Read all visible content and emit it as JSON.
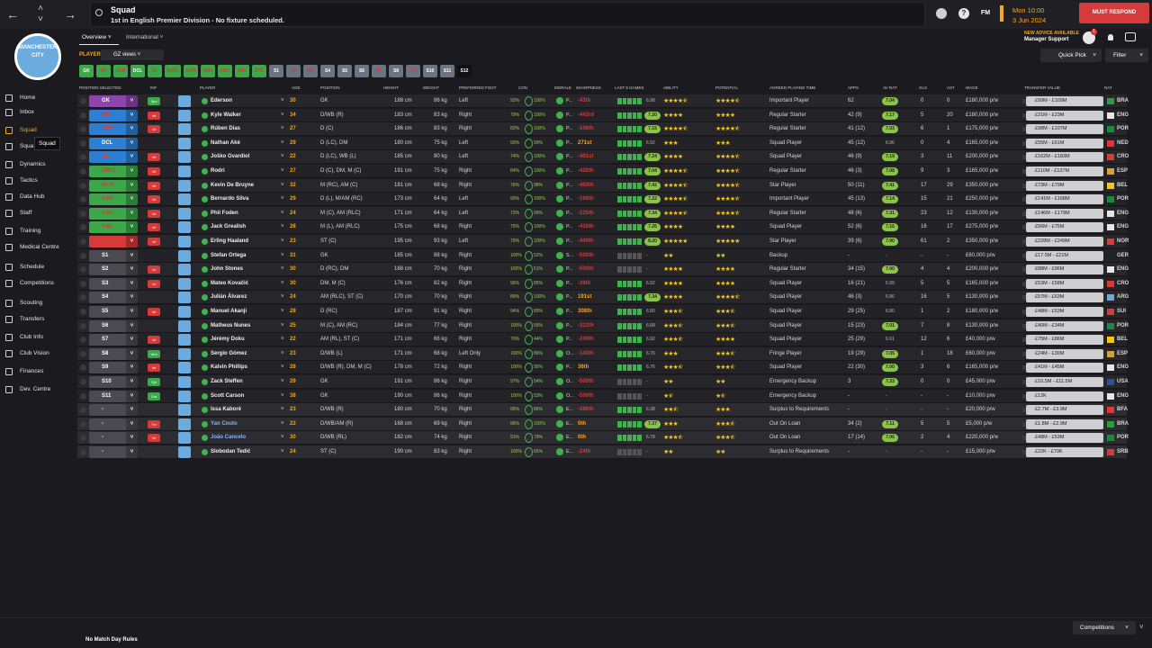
{
  "topbar": {
    "back": "←",
    "up": "˄",
    "down": "˅",
    "forward": "→",
    "title": "Squad",
    "subtitle": "1st in English Premier Division - No fixture scheduled.",
    "help": "?",
    "fm": "FM",
    "date_time": "Mon 10:00",
    "date": "3 Jun 2024",
    "must_respond": "MUST RESPOND"
  },
  "club": {
    "crest_text": "MANCHESTER CITY"
  },
  "sidebar": {
    "items": [
      {
        "label": "Home"
      },
      {
        "label": "Inbox"
      },
      {
        "label": "Squad"
      },
      {
        "label": "Squa"
      },
      {
        "label": "Dynamics"
      },
      {
        "label": "Tactics"
      },
      {
        "label": "Data Hub"
      },
      {
        "label": "Staff"
      },
      {
        "label": "Training"
      },
      {
        "label": "Medical Centre"
      },
      {
        "label": "Schedule"
      },
      {
        "label": "Competitions"
      },
      {
        "label": "Scouting"
      },
      {
        "label": "Transfers"
      },
      {
        "label": "Club Info"
      },
      {
        "label": "Club Vision"
      },
      {
        "label": "Finances"
      },
      {
        "label": "Dev. Centre"
      }
    ],
    "tooltip": "Squad"
  },
  "tabs": {
    "overview": "Overview",
    "international": "International"
  },
  "advice": {
    "new": "NEW ADVICE AVAILABLE",
    "label": "Manager Support",
    "count": "1"
  },
  "players_label": "PLAYERS",
  "view_select": "GZ views",
  "quick_pick": "Quick Pick",
  "filter": "Filter",
  "position_filters": [
    "GK",
    "DR",
    "DCR",
    "DCL",
    "DL",
    "DMCL",
    "MCR",
    "AMR",
    "AMC",
    "AML",
    "STC",
    "S1",
    "S2",
    "S3",
    "S4",
    "S5",
    "S6",
    "S7",
    "S8",
    "S9",
    "S10",
    "S11",
    "S12"
  ],
  "columns": {
    "position": "POSITION SELECTED",
    "inf": "INF",
    "player": "PLAYER",
    "age": "AGE",
    "position2": "POSITION",
    "height": "HEIGHT",
    "weight": "WEIGHT",
    "foot": "PREFERRED FOOT",
    "condition": "CON",
    "morale": "MORALE",
    "sharp": "SHARPNESS",
    "last5": "LAST 5 GAMES",
    "ability": "ABILITY",
    "potential": "POTENTIAL",
    "agreed": "AGREED PLAYING TIME",
    "apps": "APPS",
    "av_rat": "AV RAT",
    "gls": "GLS",
    "ast": "AST",
    "wage": "WAGE",
    "value": "TRANSFER VALUE",
    "nat": "NAT"
  },
  "rows": [
    {
      "pos": "GK",
      "inf": "Spd",
      "name": "Ederson",
      "age": "30",
      "position": "GK",
      "height": "188 cm",
      "weight": "86 kg",
      "foot": "Left",
      "cond": "92%",
      "fit": "100%",
      "morale": "P...",
      "sharp": "-43th",
      "last5": "6.98",
      "ab": 4.5,
      "pot": 4.5,
      "agreed": "Important Player",
      "apps": "62",
      "rat": "7.04",
      "gls": "0",
      "ast": "0",
      "wage": "£180,000 p/w",
      "value": "£99M - £109M",
      "nat": "BRA"
    },
    {
      "pos": "DR",
      "inf": "Inf",
      "name": "Kyle Walker",
      "age": "34",
      "position": "D/WB (R)",
      "height": "183 cm",
      "weight": "83 kg",
      "foot": "Right",
      "cond": "79%",
      "fit": "100%",
      "morale": "P...",
      "sharp": "-443rd",
      "last5": "7.20",
      "ab": 4,
      "pot": 4,
      "agreed": "Regular Starter",
      "apps": "42 (9)",
      "rat": "7.17",
      "gls": "5",
      "ast": "20",
      "wage": "£180,000 p/w",
      "value": "£21M - £23M",
      "nat": "ENG"
    },
    {
      "pos": "DCR",
      "inf": "Inf",
      "name": "Rúben Dias",
      "age": "27",
      "position": "D (C)",
      "height": "186 cm",
      "weight": "83 kg",
      "foot": "Right",
      "cond": "82%",
      "fit": "100%",
      "morale": "P...",
      "sharp": "-106th",
      "last5": "7.15",
      "ab": 4.5,
      "pot": 4.5,
      "agreed": "Regular Starter",
      "apps": "41 (12)",
      "rat": "7.03",
      "gls": "6",
      "ast": "1",
      "wage": "£175,000 p/w",
      "value": "£98M - £107M",
      "nat": "POR"
    },
    {
      "pos": "DCL",
      "inf": "",
      "name": "Nathan Aké",
      "age": "29",
      "position": "D (LC), DM",
      "height": "180 cm",
      "weight": "75 kg",
      "foot": "Left",
      "cond": "93%",
      "fit": "99%",
      "morale": "P...",
      "sharp": "271st",
      "last5": "6.92",
      "ab": 3,
      "pot": 3,
      "agreed": "Squad Player",
      "apps": "45 (12)",
      "rat": "6.96",
      "gls": "0",
      "ast": "4",
      "wage": "£165,000 p/w",
      "value": "£55M - £61M",
      "nat": "NED"
    },
    {
      "pos": "DL",
      "inf": "Inf",
      "name": "Joško Gvardiol",
      "age": "22",
      "position": "D (LC), WB (L)",
      "height": "185 cm",
      "weight": "80 kg",
      "foot": "Left",
      "cond": "74%",
      "fit": "100%",
      "morale": "P...",
      "sharp": "-401st",
      "last5": "7.24",
      "ab": 4,
      "pot": 4.5,
      "agreed": "Squad Player",
      "apps": "46 (9)",
      "rat": "7.19",
      "gls": "3",
      "ast": "11",
      "wage": "£200,000 p/w",
      "value": "£162M - £183M",
      "nat": "CRO"
    },
    {
      "pos": "DMCL",
      "inf": "Inf",
      "name": "Rodri",
      "age": "27",
      "position": "D (C), DM, M (C)",
      "height": "191 cm",
      "weight": "75 kg",
      "foot": "Right",
      "cond": "84%",
      "fit": "100%",
      "morale": "P...",
      "sharp": "-420th",
      "last5": "7.04",
      "ab": 4.5,
      "pot": 4.5,
      "agreed": "Regular Starter",
      "apps": "46 (3)",
      "rat": "7.08",
      "gls": "9",
      "ast": "3",
      "wage": "£165,000 p/w",
      "value": "£110M - £137M",
      "nat": "ESP"
    },
    {
      "pos": "MCR",
      "inf": "Inf",
      "name": "Kevin De Bruyne",
      "age": "32",
      "position": "M (RC), AM (C)",
      "height": "181 cm",
      "weight": "68 kg",
      "foot": "Right",
      "cond": "76%",
      "fit": "98%",
      "morale": "P...",
      "sharp": "-450th",
      "last5": "7.42",
      "ab": 4.5,
      "pot": 4.5,
      "agreed": "Star Player",
      "apps": "50 (11)",
      "rat": "7.41",
      "gls": "17",
      "ast": "29",
      "wage": "£350,000 p/w",
      "value": "£73M - £79M",
      "nat": "BEL"
    },
    {
      "pos": "AMR",
      "inf": "Inf",
      "name": "Bernardo Silva",
      "age": "29",
      "position": "D (L), M/AM (RC)",
      "height": "173 cm",
      "weight": "64 kg",
      "foot": "Left",
      "cond": "90%",
      "fit": "100%",
      "morale": "P...",
      "sharp": "-168th",
      "last5": "7.22",
      "ab": 4.5,
      "pot": 4.5,
      "agreed": "Important Player",
      "apps": "45 (13)",
      "rat": "7.14",
      "gls": "15",
      "ast": "21",
      "wage": "£250,000 p/w",
      "value": "£141M - £168M",
      "nat": "POR"
    },
    {
      "pos": "AMC",
      "inf": "Inf",
      "name": "Phil Foden",
      "age": "24",
      "position": "M (C), AM (RLC)",
      "height": "171 cm",
      "weight": "64 kg",
      "foot": "Left",
      "cond": "72%",
      "fit": "99%",
      "morale": "P...",
      "sharp": "-125th",
      "last5": "7.34",
      "ab": 4.5,
      "pot": 4.5,
      "agreed": "Regular Starter",
      "apps": "48 (6)",
      "rat": "7.31",
      "gls": "23",
      "ast": "12",
      "wage": "£130,000 p/w",
      "value": "£146M - £179M",
      "nat": "ENG"
    },
    {
      "pos": "AML",
      "inf": "Inf",
      "name": "Jack Grealish",
      "age": "28",
      "position": "M (L), AM (RLC)",
      "height": "175 cm",
      "weight": "68 kg",
      "foot": "Right",
      "cond": "75%",
      "fit": "100%",
      "morale": "P...",
      "sharp": "-416th",
      "last5": "7.26",
      "ab": 4,
      "pot": 4,
      "agreed": "Squad Player",
      "apps": "52 (6)",
      "rat": "7.16",
      "gls": "16",
      "ast": "17",
      "wage": "£275,000 p/w",
      "value": "£56M - £75M",
      "nat": "ENG"
    },
    {
      "pos": "STC",
      "inf": "Inf",
      "name": "Erling Haaland",
      "age": "23",
      "position": "ST (C)",
      "height": "195 cm",
      "weight": "93 kg",
      "foot": "Left",
      "cond": "79%",
      "fit": "100%",
      "morale": "P...",
      "sharp": "-440th",
      "last5": "8.20",
      "ab": 5,
      "pot": 5,
      "agreed": "Star Player",
      "apps": "39 (6)",
      "rat": "7.90",
      "gls": "61",
      "ast": "2",
      "wage": "£350,000 p/w",
      "value": "£228M - £249M",
      "nat": "NOR"
    },
    {
      "pos": "S1",
      "inf": "",
      "name": "Stefan Ortega",
      "age": "31",
      "position": "GK",
      "height": "185 cm",
      "weight": "88 kg",
      "foot": "Right",
      "cond": "100%",
      "fit": "52%",
      "morale": "S...",
      "sharp": "-500th",
      "last5": "-",
      "ab": 2,
      "pot": 2,
      "agreed": "Backup",
      "apps": "-",
      "rat": "-",
      "gls": "-",
      "ast": "-",
      "wage": "£60,000 p/w",
      "value": "£17.5M - £21M",
      "nat": "GER"
    },
    {
      "pos": "S2",
      "inf": "Inf",
      "name": "John Stones",
      "age": "30",
      "position": "D (RC), DM",
      "height": "188 cm",
      "weight": "70 kg",
      "foot": "Right",
      "cond": "100%",
      "fit": "51%",
      "morale": "P...",
      "sharp": "-500th",
      "last5": "-",
      "ab": 4,
      "pot": 4,
      "agreed": "Regular Starter",
      "apps": "34 (15)",
      "rat": "7.00",
      "gls": "4",
      "ast": "4",
      "wage": "£200,000 p/w",
      "value": "£88M - £96M",
      "nat": "ENG"
    },
    {
      "pos": "S3",
      "inf": "Inf",
      "name": "Mateo Kovačić",
      "age": "30",
      "position": "DM, M (C)",
      "height": "176 cm",
      "weight": "82 kg",
      "foot": "Right",
      "cond": "96%",
      "fit": "85%",
      "morale": "P...",
      "sharp": "-26th",
      "last5": "6.92",
      "ab": 4,
      "pot": 4,
      "agreed": "Squad Player",
      "apps": "16 (21)",
      "rat": "6.99",
      "gls": "5",
      "ast": "5",
      "wage": "£165,000 p/w",
      "value": "£53M - £58M",
      "nat": "CRO"
    },
    {
      "pos": "S4",
      "inf": "",
      "name": "Julián Álvarez",
      "age": "24",
      "position": "AM (RLC), ST (C)",
      "height": "170 cm",
      "weight": "70 kg",
      "foot": "Right",
      "cond": "89%",
      "fit": "100%",
      "morale": "P...",
      "sharp": "191st",
      "last5": "7.34",
      "ab": 4,
      "pot": 4.5,
      "agreed": "Squad Player",
      "apps": "46 (3)",
      "rat": "6.86",
      "gls": "16",
      "ast": "5",
      "wage": "£130,000 p/w",
      "value": "£57M - £63M",
      "nat": "ARG"
    },
    {
      "pos": "S5",
      "inf": "Inf",
      "name": "Manuel Akanji",
      "age": "28",
      "position": "D (RC)",
      "height": "187 cm",
      "weight": "91 kg",
      "foot": "Right",
      "cond": "94%",
      "fit": "89%",
      "morale": "P...",
      "sharp": "308th",
      "last5": "6.80",
      "ab": 3.5,
      "pot": 3.5,
      "agreed": "Squad Player",
      "apps": "29 (25)",
      "rat": "6.80",
      "gls": "1",
      "ast": "2",
      "wage": "£180,000 p/w",
      "value": "£48M - £53M",
      "nat": "SUI"
    },
    {
      "pos": "S6",
      "inf": "",
      "name": "Matheus Nunes",
      "age": "25",
      "position": "M (C), AM (RC)",
      "height": "184 cm",
      "weight": "77 kg",
      "foot": "Right",
      "cond": "100%",
      "fit": "55%",
      "morale": "P...",
      "sharp": "-312th",
      "last5": "6.68",
      "ab": 3.5,
      "pot": 3.5,
      "agreed": "Squad Player",
      "apps": "15 (23)",
      "rat": "7.01",
      "gls": "7",
      "ast": "8",
      "wage": "£130,000 p/w",
      "value": "£40M - £34M",
      "nat": "POR"
    },
    {
      "pos": "S7",
      "inf": "Inf",
      "name": "Jérémy Doku",
      "age": "22",
      "position": "AM (RL), ST (C)",
      "height": "171 cm",
      "weight": "66 kg",
      "foot": "Right",
      "cond": "70%",
      "fit": "44%",
      "morale": "P...",
      "sharp": "-240th",
      "last5": "6.92",
      "ab": 3.5,
      "pot": 4,
      "agreed": "Squad Player",
      "apps": "25 (29)",
      "rat": "6.91",
      "gls": "12",
      "ast": "6",
      "wage": "£40,000 p/w",
      "value": "£75M - £86M",
      "nat": "BEL"
    },
    {
      "pos": "S8",
      "inf": "Wnt",
      "name": "Sergio Gómez",
      "age": "23",
      "position": "D/WB (L)",
      "height": "171 cm",
      "weight": "68 kg",
      "foot": "Left Only",
      "cond": "100%",
      "fit": "86%",
      "morale": "O...",
      "sharp": "-143th",
      "last5": "6.76",
      "ab": 3,
      "pot": 3.5,
      "agreed": "Fringe Player",
      "apps": "19 (29)",
      "rat": "7.05",
      "gls": "1",
      "ast": "18",
      "wage": "£60,000 p/w",
      "value": "£24M - £30M",
      "nat": "ESP"
    },
    {
      "pos": "S9",
      "inf": "Inf",
      "name": "Kalvin Phillips",
      "age": "28",
      "position": "D/WB (R), DM, M (C)",
      "height": "178 cm",
      "weight": "72 kg",
      "foot": "Right",
      "cond": "100%",
      "fit": "95%",
      "morale": "P...",
      "sharp": "36th",
      "last5": "6.76",
      "ab": 3.5,
      "pot": 3.5,
      "agreed": "Squad Player",
      "apps": "22 (30)",
      "rat": "7.00",
      "gls": "3",
      "ast": "6",
      "wage": "£165,000 p/w",
      "value": "£41M - £45M",
      "nat": "ENG"
    },
    {
      "pos": "S10",
      "inf": "Spt",
      "name": "Zack Steffen",
      "age": "29",
      "position": "GK",
      "height": "191 cm",
      "weight": "86 kg",
      "foot": "Right",
      "cond": "97%",
      "fit": "54%",
      "morale": "O...",
      "sharp": "-500th",
      "last5": "-",
      "ab": 2,
      "pot": 2,
      "agreed": "Emergency Backup",
      "apps": "3",
      "rat": "7.33",
      "gls": "0",
      "ast": "0",
      "wage": "£45,000 p/w",
      "value": "£10.5M - £11.5M",
      "nat": "USA"
    },
    {
      "pos": "S11",
      "inf": "Dut",
      "name": "Scott Carson",
      "age": "38",
      "position": "GK",
      "height": "190 cm",
      "weight": "86 kg",
      "foot": "Right",
      "cond": "100%",
      "fit": "53%",
      "morale": "O...",
      "sharp": "-500th",
      "last5": "-",
      "ab": 1.5,
      "pot": 1.5,
      "agreed": "Emergency Backup",
      "apps": "-",
      "rat": "-",
      "gls": "-",
      "ast": "-",
      "wage": "£10,000 p/w",
      "value": "£12K",
      "nat": "ENG"
    },
    {
      "pos": "-",
      "inf": "",
      "name": "Issa Kaboré",
      "age": "23",
      "position": "D/WB (R)",
      "height": "180 cm",
      "weight": "70 kg",
      "foot": "Right",
      "cond": "95%",
      "fit": "86%",
      "morale": "E...",
      "sharp": "-286th",
      "last5": "6.38",
      "ab": 2.5,
      "pot": 3,
      "agreed": "Surplus to Requirements",
      "apps": "-",
      "rat": "-",
      "gls": "-",
      "ast": "-",
      "wage": "£20,000 p/w",
      "value": "£2.7M - £3.9M",
      "nat": "BFA"
    },
    {
      "pos": "-",
      "inf": "Trv",
      "name": "Yan Couto",
      "age": "22",
      "position": "D/WB/AM (R)",
      "height": "168 cm",
      "weight": "69 kg",
      "foot": "Right",
      "cond": "96%",
      "fit": "100%",
      "morale": "E...",
      "sharp": "0th",
      "last5": "7.37",
      "ab": 3,
      "pot": 3.5,
      "agreed": "Out On Loan",
      "apps": "34 (2)",
      "rat": "7.11",
      "gls": "5",
      "ast": "5",
      "wage": "£5,000 p/w",
      "value": "£1.8M - £2.9M",
      "nat": "BRA"
    },
    {
      "pos": "-",
      "inf": "Inf",
      "name": "João Cancelo",
      "age": "30",
      "position": "D/WB (RL)",
      "height": "182 cm",
      "weight": "74 kg",
      "foot": "Right",
      "cond": "91%",
      "fit": "79%",
      "morale": "E...",
      "sharp": "0th",
      "last5": "6.78",
      "ab": 3.5,
      "pot": 3.5,
      "agreed": "Out On Loan",
      "apps": "17 (14)",
      "rat": "7.06",
      "gls": "2",
      "ast": "4",
      "wage": "£220,000 p/w",
      "value": "£48M - £53M",
      "nat": "POR"
    },
    {
      "pos": "-",
      "inf": "",
      "name": "Slobodan Tedić",
      "age": "24",
      "position": "ST (C)",
      "height": "190 cm",
      "weight": "83 kg",
      "foot": "Right",
      "cond": "100%",
      "fit": "65%",
      "morale": "E...",
      "sharp": "-24th",
      "last5": "-",
      "ab": 2,
      "pot": 2,
      "agreed": "Surplus to Requirements",
      "apps": "-",
      "rat": "-",
      "gls": "-",
      "ast": "-",
      "wage": "£15,000 p/w",
      "value": "£22K - £70K",
      "nat": "SRB"
    }
  ],
  "bottom": {
    "no_match": "No Match Day Rules",
    "competitions": "Competitions"
  },
  "colors": {
    "accent": "#f5a623",
    "gk": "#8e44ad",
    "def": "#2d7fd3",
    "mid": "#3ba84a",
    "att": "#d63a3a",
    "sub": "#4a4a50",
    "must": "#d63a3a"
  }
}
